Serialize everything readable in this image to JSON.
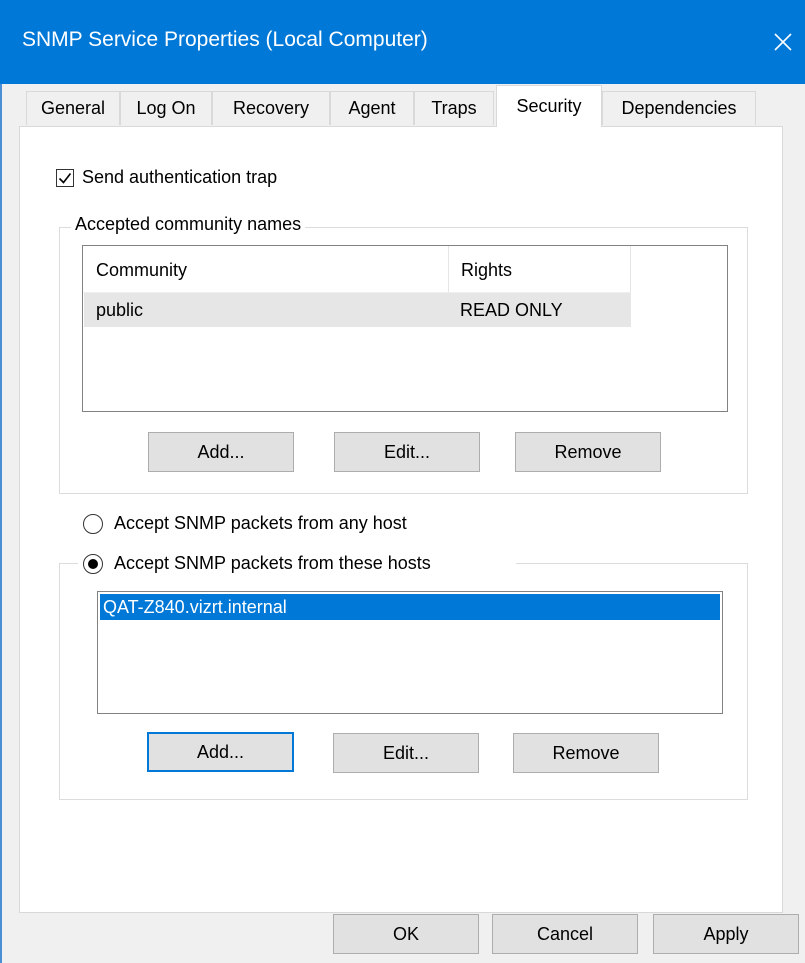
{
  "window": {
    "title": "SNMP Service Properties (Local Computer)",
    "close_icon": "close-icon",
    "accent_color": "#0078d7"
  },
  "tabs": [
    {
      "label": "General",
      "active": false
    },
    {
      "label": "Log On",
      "active": false
    },
    {
      "label": "Recovery",
      "active": false
    },
    {
      "label": "Agent",
      "active": false
    },
    {
      "label": "Traps",
      "active": false
    },
    {
      "label": "Security",
      "active": true
    },
    {
      "label": "Dependencies",
      "active": false
    }
  ],
  "security": {
    "send_auth_trap": {
      "label": "Send authentication trap",
      "checked": true
    },
    "communities": {
      "legend": "Accepted community names",
      "columns": [
        "Community",
        "Rights"
      ],
      "rows": [
        {
          "community": "public",
          "rights": "READ ONLY"
        }
      ],
      "buttons": {
        "add": "Add...",
        "edit": "Edit...",
        "remove": "Remove"
      }
    },
    "accept_any": {
      "label": "Accept SNMP packets from any host",
      "selected": false
    },
    "accept_these": {
      "label": "Accept SNMP packets from these hosts",
      "selected": true
    },
    "hosts": {
      "items": [
        "QAT-Z840.vizrt.internal"
      ],
      "selected_index": 0,
      "buttons": {
        "add": "Add...",
        "edit": "Edit...",
        "remove": "Remove"
      }
    }
  },
  "footer": {
    "ok": "OK",
    "cancel": "Cancel",
    "apply": "Apply"
  }
}
